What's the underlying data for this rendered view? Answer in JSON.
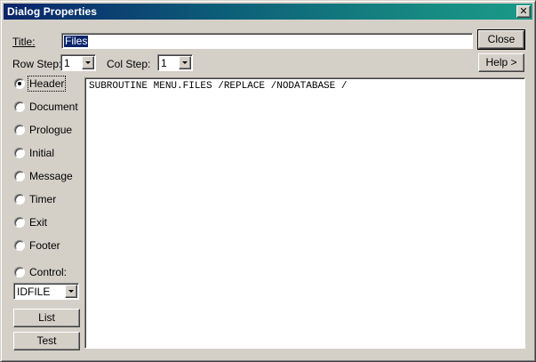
{
  "window": {
    "title": "Dialog Properties",
    "close_glyph": "✕"
  },
  "form": {
    "title_label": "Title:",
    "title_value": "Files",
    "row_step_label": "Row Step:",
    "row_step_value": "1",
    "col_step_label": "Col Step:",
    "col_step_value": "1"
  },
  "buttons": {
    "close": "Close",
    "help": "Help >",
    "list": "List",
    "test": "Test"
  },
  "sections": [
    {
      "label": "Header",
      "checked": true
    },
    {
      "label": "Document",
      "checked": false
    },
    {
      "label": "Prologue",
      "checked": false
    },
    {
      "label": "Initial",
      "checked": false
    },
    {
      "label": "Message",
      "checked": false
    },
    {
      "label": "Timer",
      "checked": false
    },
    {
      "label": "Exit",
      "checked": false
    },
    {
      "label": "Footer",
      "checked": false
    },
    {
      "label": "Control:",
      "checked": false
    }
  ],
  "control_combo": {
    "value": "IDFILE"
  },
  "editor": {
    "content": "SUBROUTINE MENU.FILES /REPLACE /NODATABASE /"
  }
}
